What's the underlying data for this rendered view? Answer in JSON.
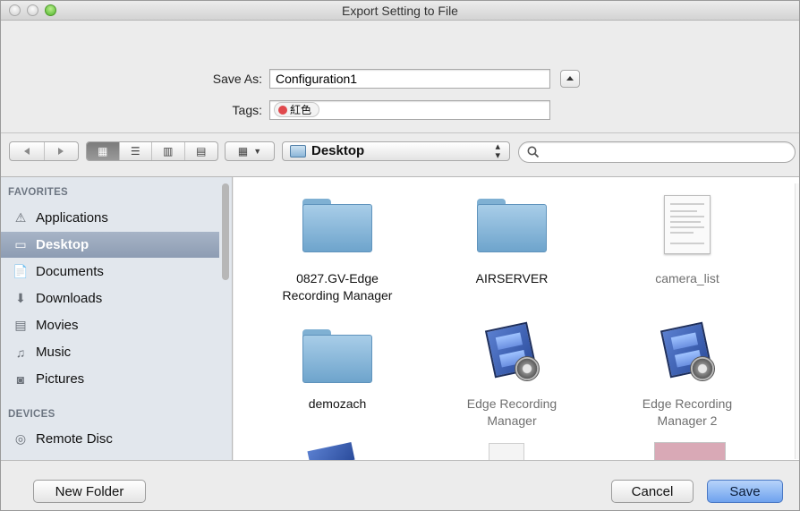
{
  "window": {
    "title": "Export Setting to File"
  },
  "form": {
    "save_as_label": "Save As:",
    "save_as_value": "Configuration1",
    "tags_label": "Tags:",
    "tag_name": "紅色",
    "tag_color": "#e0494d"
  },
  "toolbar": {
    "location": "Desktop",
    "search_placeholder": ""
  },
  "sidebar": {
    "favorites_header": "FAVORITES",
    "favorites": [
      {
        "label": "Applications",
        "icon": "applications-icon",
        "selected": false
      },
      {
        "label": "Desktop",
        "icon": "desktop-icon",
        "selected": true
      },
      {
        "label": "Documents",
        "icon": "documents-icon",
        "selected": false
      },
      {
        "label": "Downloads",
        "icon": "downloads-icon",
        "selected": false
      },
      {
        "label": "Movies",
        "icon": "movies-icon",
        "selected": false
      },
      {
        "label": "Music",
        "icon": "music-icon",
        "selected": false
      },
      {
        "label": "Pictures",
        "icon": "pictures-icon",
        "selected": false
      }
    ],
    "devices_header": "DEVICES",
    "devices": [
      {
        "label": "Remote Disc",
        "icon": "remote-disc-icon"
      }
    ]
  },
  "files": [
    {
      "line1": "0827.GV-Edge",
      "line2": "Recording Manager",
      "kind": "folder",
      "dim": false
    },
    {
      "line1": "AIRSERVER",
      "line2": "",
      "kind": "folder",
      "dim": false
    },
    {
      "line1": "camera_list",
      "line2": "",
      "kind": "document",
      "dim": true
    },
    {
      "line1": "demozach",
      "line2": "",
      "kind": "folder",
      "dim": false
    },
    {
      "line1": "Edge Recording",
      "line2": "Manager",
      "kind": "app",
      "dim": true
    },
    {
      "line1": "Edge Recording",
      "line2": "Manager 2",
      "kind": "app",
      "dim": true
    }
  ],
  "buttons": {
    "new_folder": "New Folder",
    "cancel": "Cancel",
    "save": "Save"
  },
  "colors": {
    "sidebar_bg": "#e2e7ed",
    "selection": "#8d9cb3",
    "default_button": "#6ea2ee",
    "folder": "#7fb0d3"
  }
}
